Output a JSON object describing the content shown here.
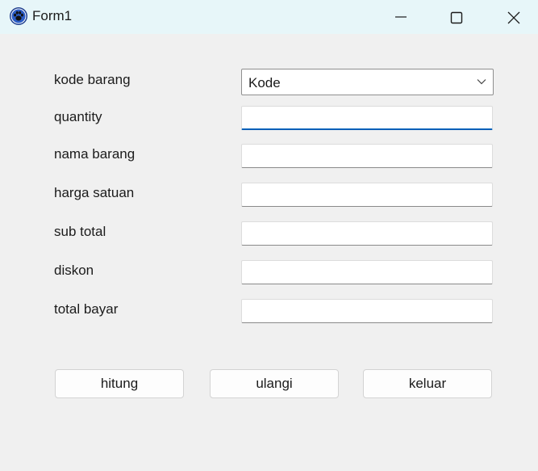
{
  "window": {
    "title": "Form1"
  },
  "form": {
    "kode_barang_label": "kode barang",
    "kode_barang_value": "Kode",
    "quantity_label": "quantity",
    "quantity_value": "",
    "nama_barang_label": "nama barang",
    "nama_barang_value": "",
    "harga_satuan_label": "harga satuan",
    "harga_satuan_value": "",
    "sub_total_label": "sub total",
    "sub_total_value": "",
    "diskon_label": "diskon",
    "diskon_value": "",
    "total_bayar_label": "total bayar",
    "total_bayar_value": ""
  },
  "buttons": {
    "hitung": "hitung",
    "ulangi": "ulangi",
    "keluar": "keluar"
  },
  "colors": {
    "titlebar": "#e7f6f9",
    "background": "#f0f0f0",
    "focus_accent": "#005fb8"
  },
  "icons": {
    "app": "paw-app-icon",
    "minimize": "minimize-icon",
    "maximize": "maximize-icon",
    "close": "close-icon",
    "dropdown": "chevron-down-icon"
  }
}
